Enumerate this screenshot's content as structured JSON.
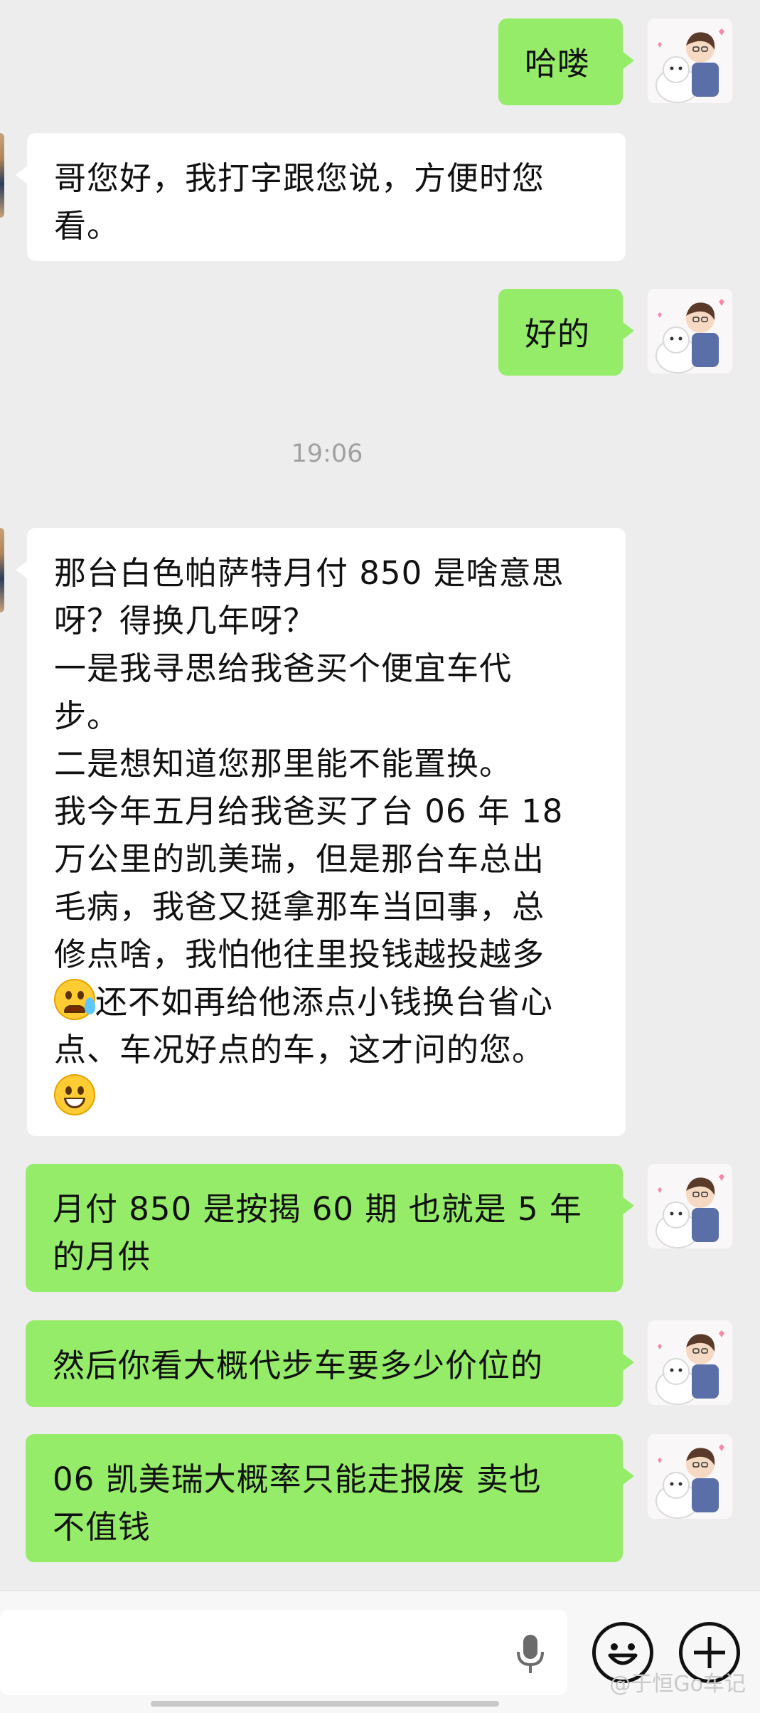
{
  "messages": [
    {
      "from": "me",
      "lines": [
        "哈喽"
      ]
    },
    {
      "from": "them",
      "lines": [
        "哥您好，我打字跟您说，方便时您",
        "看。"
      ]
    },
    {
      "from": "me",
      "lines": [
        "好的"
      ]
    },
    {
      "from": "them",
      "lines": [
        "那台白色帕萨特月付 850 是啥意思",
        "呀？得换几年呀？",
        "一是我寻思给我爸买个便宜车代",
        "步。",
        "二是想知道您那里能不能置换。",
        "我今年五月给我爸买了台 06 年 18",
        "万公里的凯美瑞，但是那台车总出",
        "毛病，我爸又挺拿那车当回事，总",
        "修点啥，我怕他往里投钱越投越多",
        "还不如再给他添点小钱换台省心",
        "点、车况好点的车，这才问的您。"
      ]
    },
    {
      "from": "me",
      "lines": [
        "月付 850 是按揭 60 期 也就是 5 年",
        "的月供"
      ]
    },
    {
      "from": "me",
      "lines": [
        "然后你看大概代步车要多少价位的"
      ]
    },
    {
      "from": "me",
      "lines": [
        "06 凯美瑞大概率只能走报废 卖也",
        "不值钱"
      ]
    }
  ],
  "timestamp": "19:06",
  "emoji_names": [
    "face-crying-laughing",
    "grinning-face"
  ],
  "watermark": "@于恒Go车记",
  "colors": {
    "my_bubble": "#95ec69",
    "their_bubble": "#ffffff",
    "background": "#ededed"
  }
}
